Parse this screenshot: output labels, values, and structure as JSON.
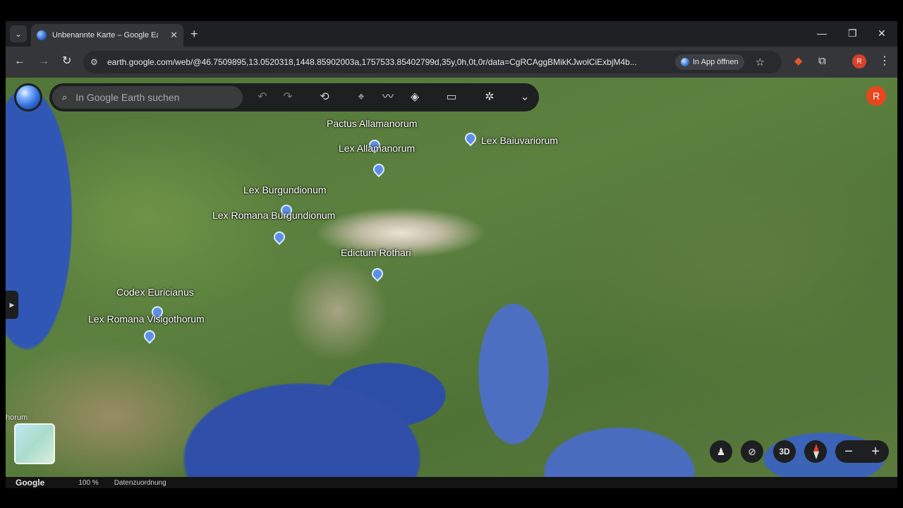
{
  "browser": {
    "tab_title": "Unbenannte Karte – Google Ea",
    "new_tab": "+",
    "url": "earth.google.com/web/@46.7509895,13.0520318,1448.85902003a,1757533.85402799d,35y,0h,0t,0r/data=CgRCAggBMikKJwolCiExbjM4b...",
    "open_in_app": "In App öffnen",
    "profile_initial": "R"
  },
  "earth": {
    "search_placeholder": "In Google Earth suchen",
    "profile_initial": "R",
    "icons": [
      "undo-icon",
      "redo-icon",
      "history-icon",
      "pin-icon",
      "path-icon",
      "layers-icon",
      "ruler-icon",
      "satellite-icon",
      "chevron-down-icon"
    ]
  },
  "places": [
    {
      "name": "Pactus Allamanorum"
    },
    {
      "name": "Lex Allamanorum"
    },
    {
      "name": "Lex Baiuvariorum"
    },
    {
      "name": "Lex Burgundionum"
    },
    {
      "name": "Lex Romana Burgundionum"
    },
    {
      "name": "Edictum Rothari"
    },
    {
      "name": "Codex Euricianus"
    },
    {
      "name": "Lex Romana Visigothorum"
    }
  ],
  "thumb_label": "horum",
  "controls": {
    "three_d": "3D",
    "zoom_out": "−",
    "zoom_in": "+"
  },
  "status": {
    "brand": "Google",
    "zoom": "100 %",
    "attribution": "Datenzuordnung"
  },
  "colors": {
    "profile_red": "#e8461f",
    "compass_north": "#e8412c"
  }
}
